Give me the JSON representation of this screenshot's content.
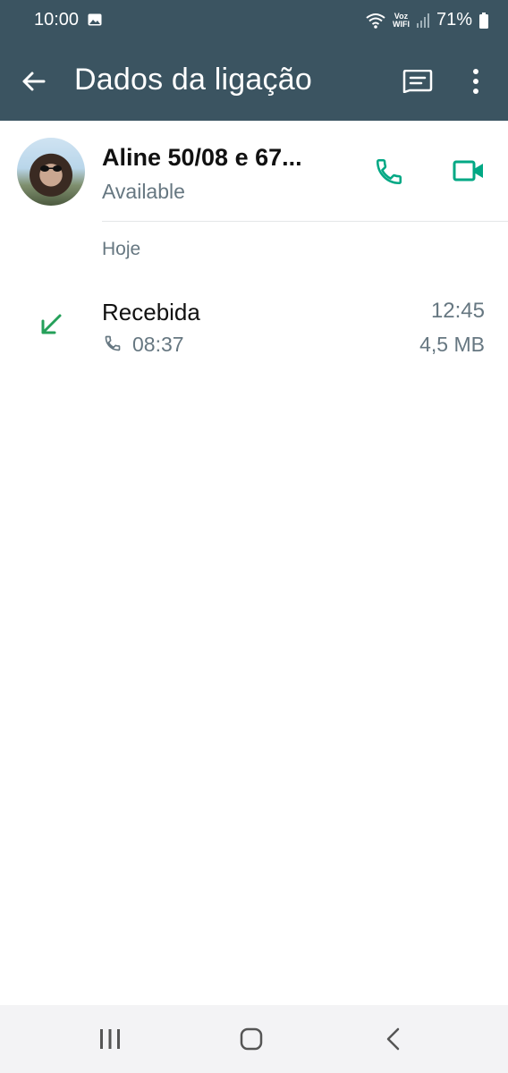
{
  "status_bar": {
    "time": "10:00",
    "voz": "Voz",
    "wifi_label": "WIFI",
    "battery": "71%"
  },
  "toolbar": {
    "title": "Dados da ligação"
  },
  "contact": {
    "name": "Aline 50/08 e 67...",
    "status": "Available"
  },
  "call_log": {
    "section_label": "Hoje",
    "entries": [
      {
        "type": "Recebida",
        "duration": "08:37",
        "time": "12:45",
        "size": "4,5 MB"
      }
    ]
  },
  "icons": {
    "back": "arrow-left-icon",
    "message": "message-icon",
    "more": "more-vertical-icon",
    "call": "phone-icon",
    "video": "video-icon",
    "incoming": "incoming-arrow-icon"
  },
  "colors": {
    "header": "#3b5461",
    "accent": "#00a884",
    "secondary_text": "#667781"
  }
}
